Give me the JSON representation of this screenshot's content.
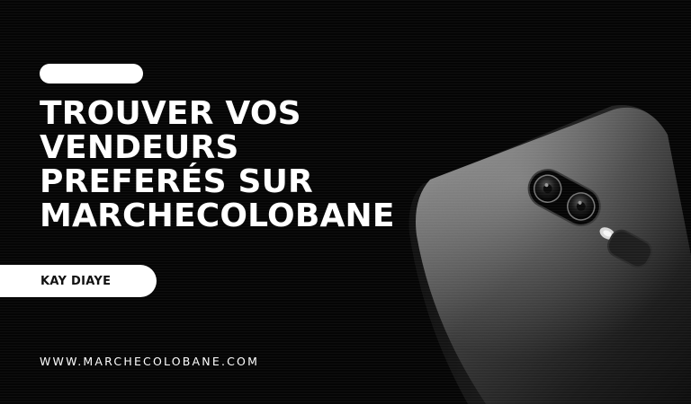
{
  "headline": {
    "lines": [
      "TROUVER VOS",
      "VENDEURS",
      "PREFERÉS SUR",
      "MARCHECOLOBANE"
    ]
  },
  "author": {
    "name": "KAY DIAYE"
  },
  "footer": {
    "website": "WWW.MARCHECOLOBANE.COM"
  },
  "colors": {
    "background": "#050505",
    "text": "#ffffff",
    "pill": "#ffffff",
    "pill_text": "#111111"
  },
  "images": {
    "hero": "smartphone-rear-camera-photo"
  }
}
